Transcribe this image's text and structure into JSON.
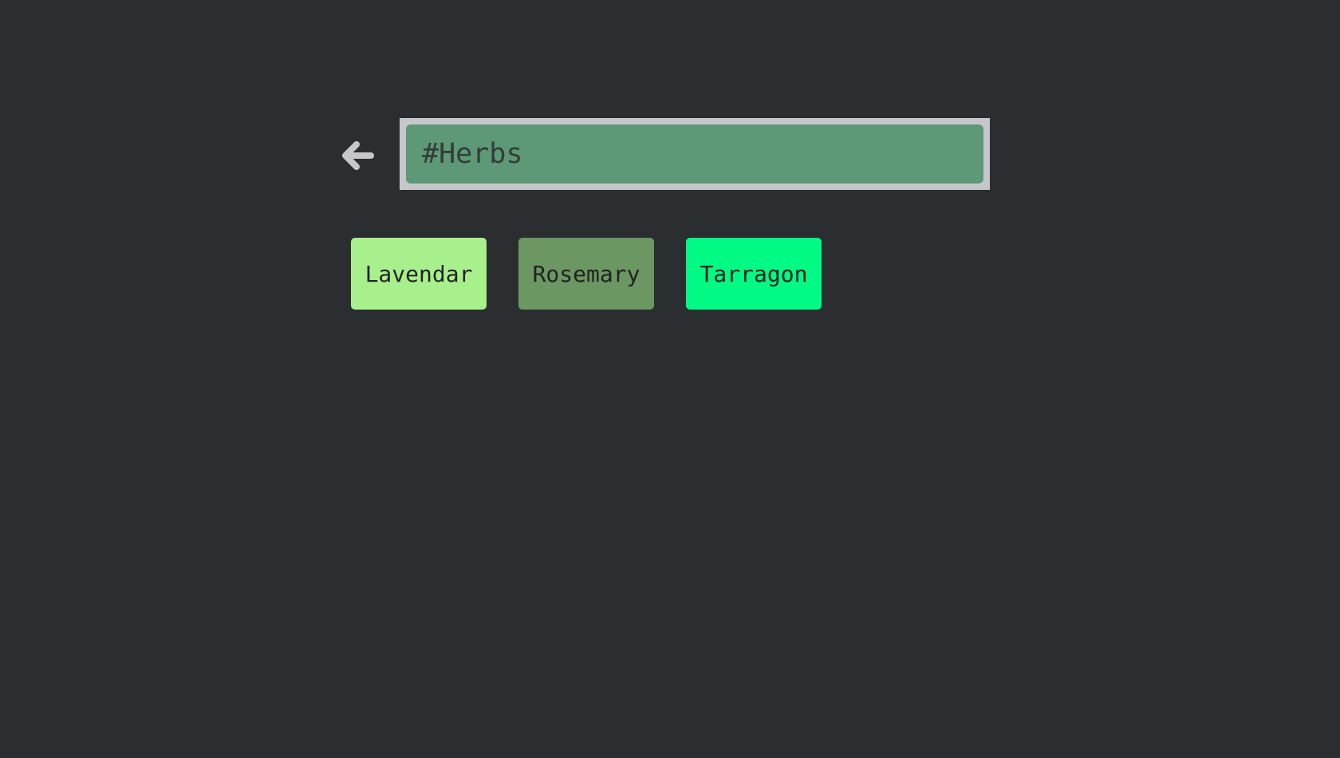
{
  "colors": {
    "background": "#2a2e31",
    "search_frame": "#c6c7cb",
    "search_fill": "#5d9877",
    "back_icon": "#c6c7cb"
  },
  "back_button": {
    "icon": "arrow-left-icon"
  },
  "search": {
    "value": "#Herbs"
  },
  "tags": [
    {
      "label": "Lavendar",
      "color": "#a8f08c"
    },
    {
      "label": "Rosemary",
      "color": "#6a9762"
    },
    {
      "label": "Tarragon",
      "color": "#00fa83"
    }
  ]
}
